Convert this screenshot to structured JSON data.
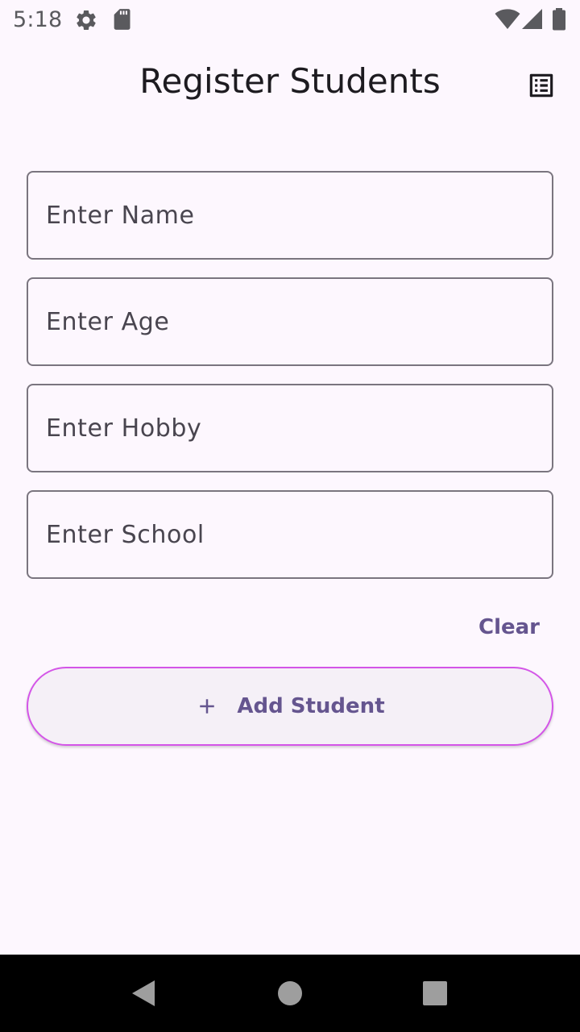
{
  "status_bar": {
    "time": "5:18",
    "icons": [
      "settings-icon",
      "sd-card-icon",
      "wifi-icon",
      "cell-signal-icon",
      "battery-icon"
    ]
  },
  "app_bar": {
    "title": "Register Students",
    "action_icon": "notes-icon"
  },
  "form": {
    "fields": [
      {
        "placeholder": "Enter Name",
        "value": ""
      },
      {
        "placeholder": "Enter Age",
        "value": ""
      },
      {
        "placeholder": "Enter Hobby",
        "value": ""
      },
      {
        "placeholder": "Enter School",
        "value": ""
      }
    ],
    "clear_label": "Clear",
    "add_label": "Add Student",
    "add_icon": "plus-icon"
  },
  "nav_bar": {
    "icons": [
      "back-icon",
      "home-icon",
      "recents-icon"
    ]
  },
  "colors": {
    "background": "#fdf7fe",
    "accent": "#65558f",
    "button_border": "#d455e8",
    "outline": "#7a757f"
  }
}
